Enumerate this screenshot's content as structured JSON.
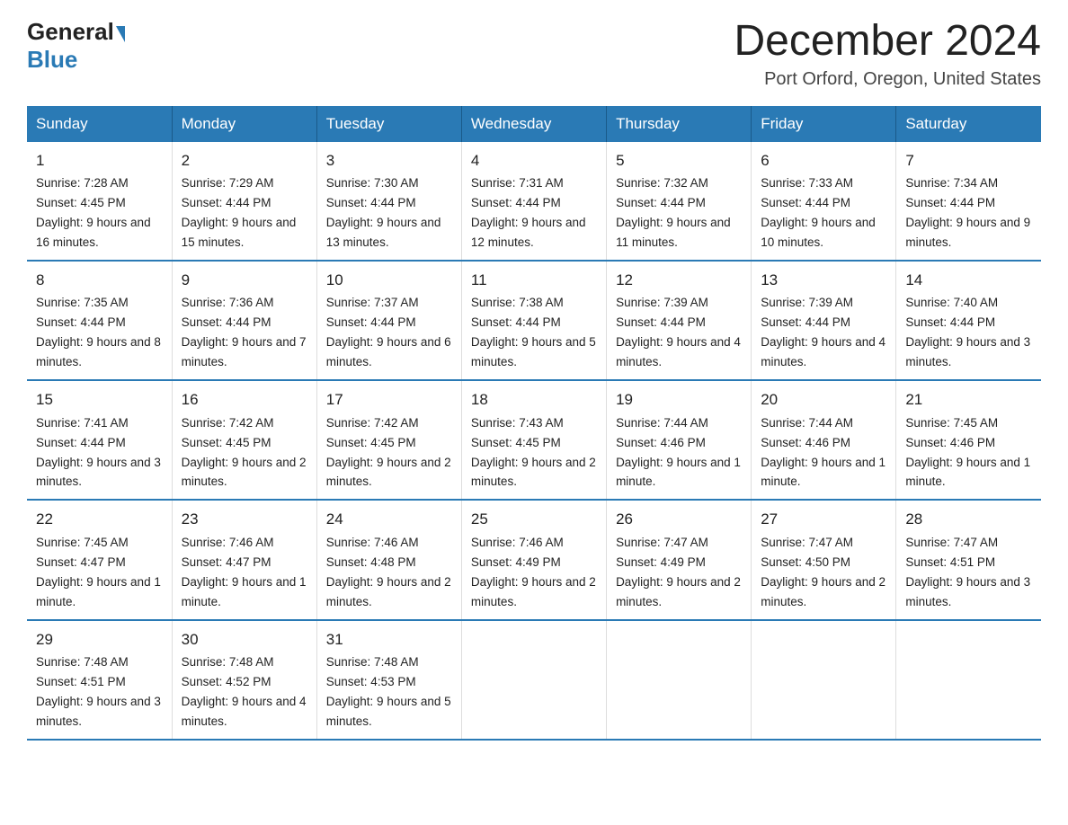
{
  "header": {
    "logo_general": "General",
    "logo_blue": "Blue",
    "title": "December 2024",
    "subtitle": "Port Orford, Oregon, United States"
  },
  "days_of_week": [
    "Sunday",
    "Monday",
    "Tuesday",
    "Wednesday",
    "Thursday",
    "Friday",
    "Saturday"
  ],
  "weeks": [
    [
      {
        "day": "1",
        "sunrise": "7:28 AM",
        "sunset": "4:45 PM",
        "daylight": "9 hours and 16 minutes."
      },
      {
        "day": "2",
        "sunrise": "7:29 AM",
        "sunset": "4:44 PM",
        "daylight": "9 hours and 15 minutes."
      },
      {
        "day": "3",
        "sunrise": "7:30 AM",
        "sunset": "4:44 PM",
        "daylight": "9 hours and 13 minutes."
      },
      {
        "day": "4",
        "sunrise": "7:31 AM",
        "sunset": "4:44 PM",
        "daylight": "9 hours and 12 minutes."
      },
      {
        "day": "5",
        "sunrise": "7:32 AM",
        "sunset": "4:44 PM",
        "daylight": "9 hours and 11 minutes."
      },
      {
        "day": "6",
        "sunrise": "7:33 AM",
        "sunset": "4:44 PM",
        "daylight": "9 hours and 10 minutes."
      },
      {
        "day": "7",
        "sunrise": "7:34 AM",
        "sunset": "4:44 PM",
        "daylight": "9 hours and 9 minutes."
      }
    ],
    [
      {
        "day": "8",
        "sunrise": "7:35 AM",
        "sunset": "4:44 PM",
        "daylight": "9 hours and 8 minutes."
      },
      {
        "day": "9",
        "sunrise": "7:36 AM",
        "sunset": "4:44 PM",
        "daylight": "9 hours and 7 minutes."
      },
      {
        "day": "10",
        "sunrise": "7:37 AM",
        "sunset": "4:44 PM",
        "daylight": "9 hours and 6 minutes."
      },
      {
        "day": "11",
        "sunrise": "7:38 AM",
        "sunset": "4:44 PM",
        "daylight": "9 hours and 5 minutes."
      },
      {
        "day": "12",
        "sunrise": "7:39 AM",
        "sunset": "4:44 PM",
        "daylight": "9 hours and 4 minutes."
      },
      {
        "day": "13",
        "sunrise": "7:39 AM",
        "sunset": "4:44 PM",
        "daylight": "9 hours and 4 minutes."
      },
      {
        "day": "14",
        "sunrise": "7:40 AM",
        "sunset": "4:44 PM",
        "daylight": "9 hours and 3 minutes."
      }
    ],
    [
      {
        "day": "15",
        "sunrise": "7:41 AM",
        "sunset": "4:44 PM",
        "daylight": "9 hours and 3 minutes."
      },
      {
        "day": "16",
        "sunrise": "7:42 AM",
        "sunset": "4:45 PM",
        "daylight": "9 hours and 2 minutes."
      },
      {
        "day": "17",
        "sunrise": "7:42 AM",
        "sunset": "4:45 PM",
        "daylight": "9 hours and 2 minutes."
      },
      {
        "day": "18",
        "sunrise": "7:43 AM",
        "sunset": "4:45 PM",
        "daylight": "9 hours and 2 minutes."
      },
      {
        "day": "19",
        "sunrise": "7:44 AM",
        "sunset": "4:46 PM",
        "daylight": "9 hours and 1 minute."
      },
      {
        "day": "20",
        "sunrise": "7:44 AM",
        "sunset": "4:46 PM",
        "daylight": "9 hours and 1 minute."
      },
      {
        "day": "21",
        "sunrise": "7:45 AM",
        "sunset": "4:46 PM",
        "daylight": "9 hours and 1 minute."
      }
    ],
    [
      {
        "day": "22",
        "sunrise": "7:45 AM",
        "sunset": "4:47 PM",
        "daylight": "9 hours and 1 minute."
      },
      {
        "day": "23",
        "sunrise": "7:46 AM",
        "sunset": "4:47 PM",
        "daylight": "9 hours and 1 minute."
      },
      {
        "day": "24",
        "sunrise": "7:46 AM",
        "sunset": "4:48 PM",
        "daylight": "9 hours and 2 minutes."
      },
      {
        "day": "25",
        "sunrise": "7:46 AM",
        "sunset": "4:49 PM",
        "daylight": "9 hours and 2 minutes."
      },
      {
        "day": "26",
        "sunrise": "7:47 AM",
        "sunset": "4:49 PM",
        "daylight": "9 hours and 2 minutes."
      },
      {
        "day": "27",
        "sunrise": "7:47 AM",
        "sunset": "4:50 PM",
        "daylight": "9 hours and 2 minutes."
      },
      {
        "day": "28",
        "sunrise": "7:47 AM",
        "sunset": "4:51 PM",
        "daylight": "9 hours and 3 minutes."
      }
    ],
    [
      {
        "day": "29",
        "sunrise": "7:48 AM",
        "sunset": "4:51 PM",
        "daylight": "9 hours and 3 minutes."
      },
      {
        "day": "30",
        "sunrise": "7:48 AM",
        "sunset": "4:52 PM",
        "daylight": "9 hours and 4 minutes."
      },
      {
        "day": "31",
        "sunrise": "7:48 AM",
        "sunset": "4:53 PM",
        "daylight": "9 hours and 5 minutes."
      },
      null,
      null,
      null,
      null
    ]
  ]
}
